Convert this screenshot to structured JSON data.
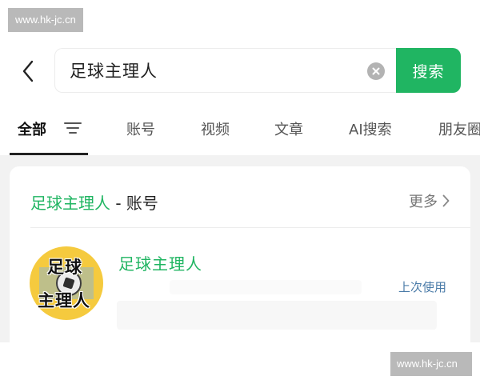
{
  "watermark": {
    "top": "www.hk-jc.cn",
    "bottom": "www.hk-jc.cn"
  },
  "search": {
    "query": "足球主理人",
    "button_label": "搜索"
  },
  "tabs": [
    {
      "label": "全部",
      "active": true
    },
    {
      "label": "账号",
      "active": false
    },
    {
      "label": "视频",
      "active": false
    },
    {
      "label": "文章",
      "active": false
    },
    {
      "label": "AI搜索",
      "active": false
    },
    {
      "label": "朋友圈",
      "active": false
    }
  ],
  "section": {
    "keyword": "足球主理人",
    "suffix": " - 账号",
    "more_label": "更多"
  },
  "account": {
    "name": "足球主理人",
    "status": "上次使用",
    "avatar_text_line1": "足球",
    "avatar_text_line2": "主理人"
  },
  "colors": {
    "accent": "#20b562",
    "link": "#4a7ba8",
    "avatar_bg": "#f5ca3e"
  },
  "icons": [
    "back-arrow-icon",
    "clear-icon",
    "filter-icon",
    "chevron-right-icon",
    "football-icon"
  ]
}
